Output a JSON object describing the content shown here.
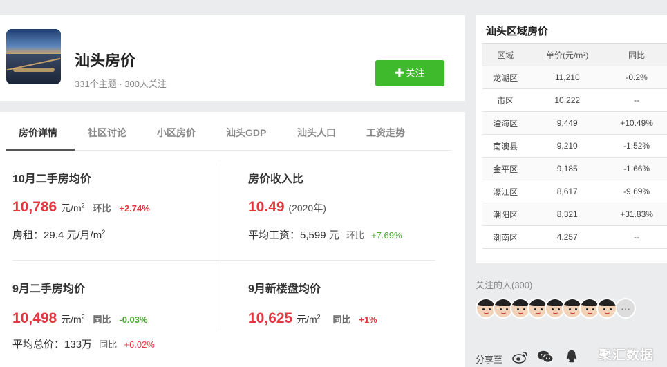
{
  "topic": {
    "title": "汕头房价",
    "meta": "331个主题 · 300人关注",
    "follow_label": "关注"
  },
  "tabs": [
    "房价详情",
    "社区讨论",
    "小区房价",
    "汕头GDP",
    "汕头人口",
    "工资走势"
  ],
  "stats": {
    "oct_resale": {
      "title": "10月二手房均价",
      "value": "10,786",
      "unit": "元/m",
      "unit_sup": "2",
      "cmp_label": "环比",
      "cmp_value": "+2.74%",
      "rent_label": "房租：",
      "rent_value": "29.4",
      "rent_unit": "元/月/m",
      "rent_sup": "2"
    },
    "price_income": {
      "title": "房价收入比",
      "value": "10.49",
      "year": "(2020年)",
      "wage_label": "平均工资：",
      "wage_value": "5,599",
      "wage_unit": "元",
      "cmp_label": "环比",
      "cmp_value": "+7.69%"
    },
    "sep_resale": {
      "title": "9月二手房均价",
      "value": "10,498",
      "unit": "元/m",
      "unit_sup": "2",
      "cmp_label": "同比",
      "cmp_value": "-0.03%",
      "total_label": "平均总价：",
      "total_value": "133万",
      "total_cmp_label": "同比",
      "total_cmp_value": "+6.02%"
    },
    "sep_new": {
      "title": "9月新楼盘均价",
      "value": "10,625",
      "unit": "元/m",
      "unit_sup": "2",
      "cmp_label": "同比",
      "cmp_value": "+1%"
    }
  },
  "region": {
    "title": "汕头区域房价",
    "headers": [
      "区域",
      "单价(元/m²)",
      "同比"
    ],
    "rows": [
      {
        "name": "龙湖区",
        "price": "11,210",
        "change": "-0.2%",
        "trend": "down"
      },
      {
        "name": "市区",
        "price": "10,222",
        "change": "--",
        "trend": "flat"
      },
      {
        "name": "澄海区",
        "price": "9,449",
        "change": "+10.49%",
        "trend": "up"
      },
      {
        "name": "南澳县",
        "price": "9,210",
        "change": "-1.52%",
        "trend": "down"
      },
      {
        "name": "金平区",
        "price": "9,185",
        "change": "-1.66%",
        "trend": "down"
      },
      {
        "name": "濠江区",
        "price": "8,617",
        "change": "-9.69%",
        "trend": "down"
      },
      {
        "name": "潮阳区",
        "price": "8,321",
        "change": "+31.83%",
        "trend": "up"
      },
      {
        "name": "潮南区",
        "price": "4,257",
        "change": "--",
        "trend": "flat"
      }
    ]
  },
  "followers": {
    "label": "关注的人(300)",
    "more": "···"
  },
  "share": {
    "label": "分享至",
    "icons": [
      "weibo-icon",
      "wechat-icon",
      "qq-icon"
    ]
  },
  "watermark": "聚汇数据",
  "colors": {
    "accent_green": "#3fba2c",
    "up_red": "#e2373f",
    "down_green": "#4aa832"
  }
}
